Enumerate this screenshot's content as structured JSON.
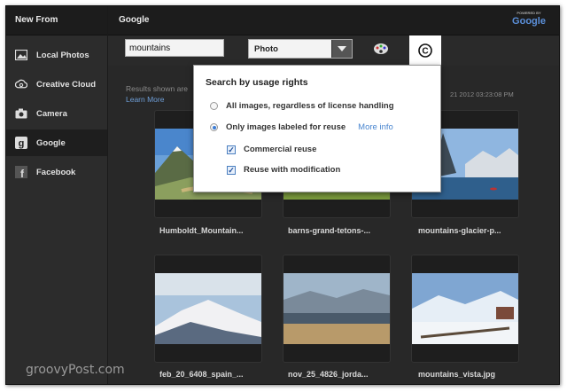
{
  "sidebar": {
    "header": "New From",
    "items": [
      {
        "label": "Local Photos",
        "icon": "photo-icon"
      },
      {
        "label": "Creative Cloud",
        "icon": "creative-cloud-icon"
      },
      {
        "label": "Camera",
        "icon": "camera-icon"
      },
      {
        "label": "Google",
        "icon": "google-icon",
        "active": true
      },
      {
        "label": "Facebook",
        "icon": "facebook-icon"
      }
    ]
  },
  "main": {
    "header": "Google",
    "badge_small": "POWERED BY",
    "badge_brand": "Google"
  },
  "search": {
    "value": "mountains",
    "type_value": "Photo"
  },
  "results": {
    "text": "Results shown are",
    "learn_more": "Learn More",
    "timestamp": "21 2012 03:23:08 PM",
    "thumbnails": [
      {
        "label": "Humboldt_Mountain..."
      },
      {
        "label": "barns-grand-tetons-..."
      },
      {
        "label": "mountains-glacier-p..."
      },
      {
        "label": "feb_20_6408_spain_..."
      },
      {
        "label": "nov_25_4826_jorda..."
      },
      {
        "label": "mountains_vista.jpg"
      }
    ]
  },
  "popup": {
    "title": "Search by usage rights",
    "option_all": "All images, regardless of license handling",
    "option_reuse": "Only images labeled for reuse",
    "more_info": "More info",
    "check_commercial": "Commercial reuse",
    "check_modification": "Reuse with modification",
    "selected_option": "reuse",
    "commercial_checked": true,
    "modification_checked": true
  },
  "watermark": "groovyPost.com",
  "colors": {
    "link": "#4a86d0",
    "background": "#262626",
    "popup": "#ffffff"
  }
}
